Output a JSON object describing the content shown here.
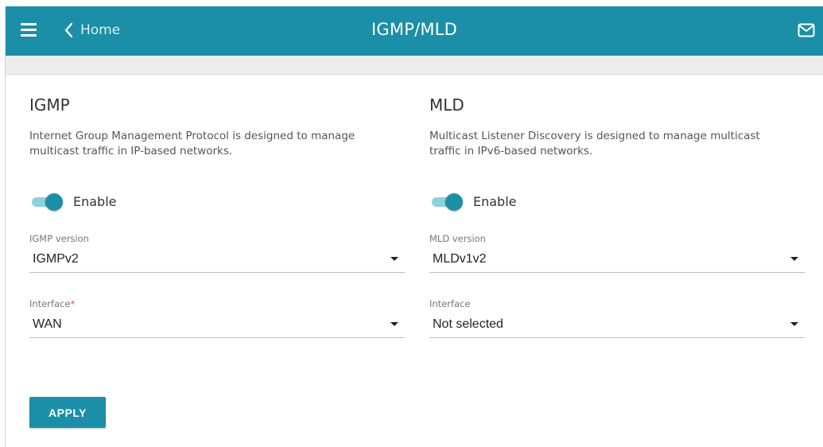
{
  "header": {
    "back_label": "Home",
    "title": "IGMP/MLD",
    "menu_icon": "hamburger-icon",
    "back_icon": "chevron-left-icon",
    "mail_icon": "mail-icon"
  },
  "colors": {
    "accent": "#1a8fa7",
    "toggle_track": "#8fcfdf",
    "required": "#d9534f"
  },
  "igmp": {
    "title": "IGMP",
    "description": "Internet Group Management Protocol is designed to manage multicast traffic in IP-based networks.",
    "enable_label": "Enable",
    "enabled": true,
    "version_label": "IGMP version",
    "version_value": "IGMPv2",
    "interface_label": "Interface",
    "interface_required_mark": "*",
    "interface_value": "WAN"
  },
  "mld": {
    "title": "MLD",
    "description": "Multicast Listener Discovery is designed to manage multicast traffic in IPv6-based networks.",
    "enable_label": "Enable",
    "enabled": true,
    "version_label": "MLD version",
    "version_value": "MLDv1v2",
    "interface_label": "Interface",
    "interface_value": "Not selected"
  },
  "actions": {
    "apply_label": "APPLY"
  }
}
